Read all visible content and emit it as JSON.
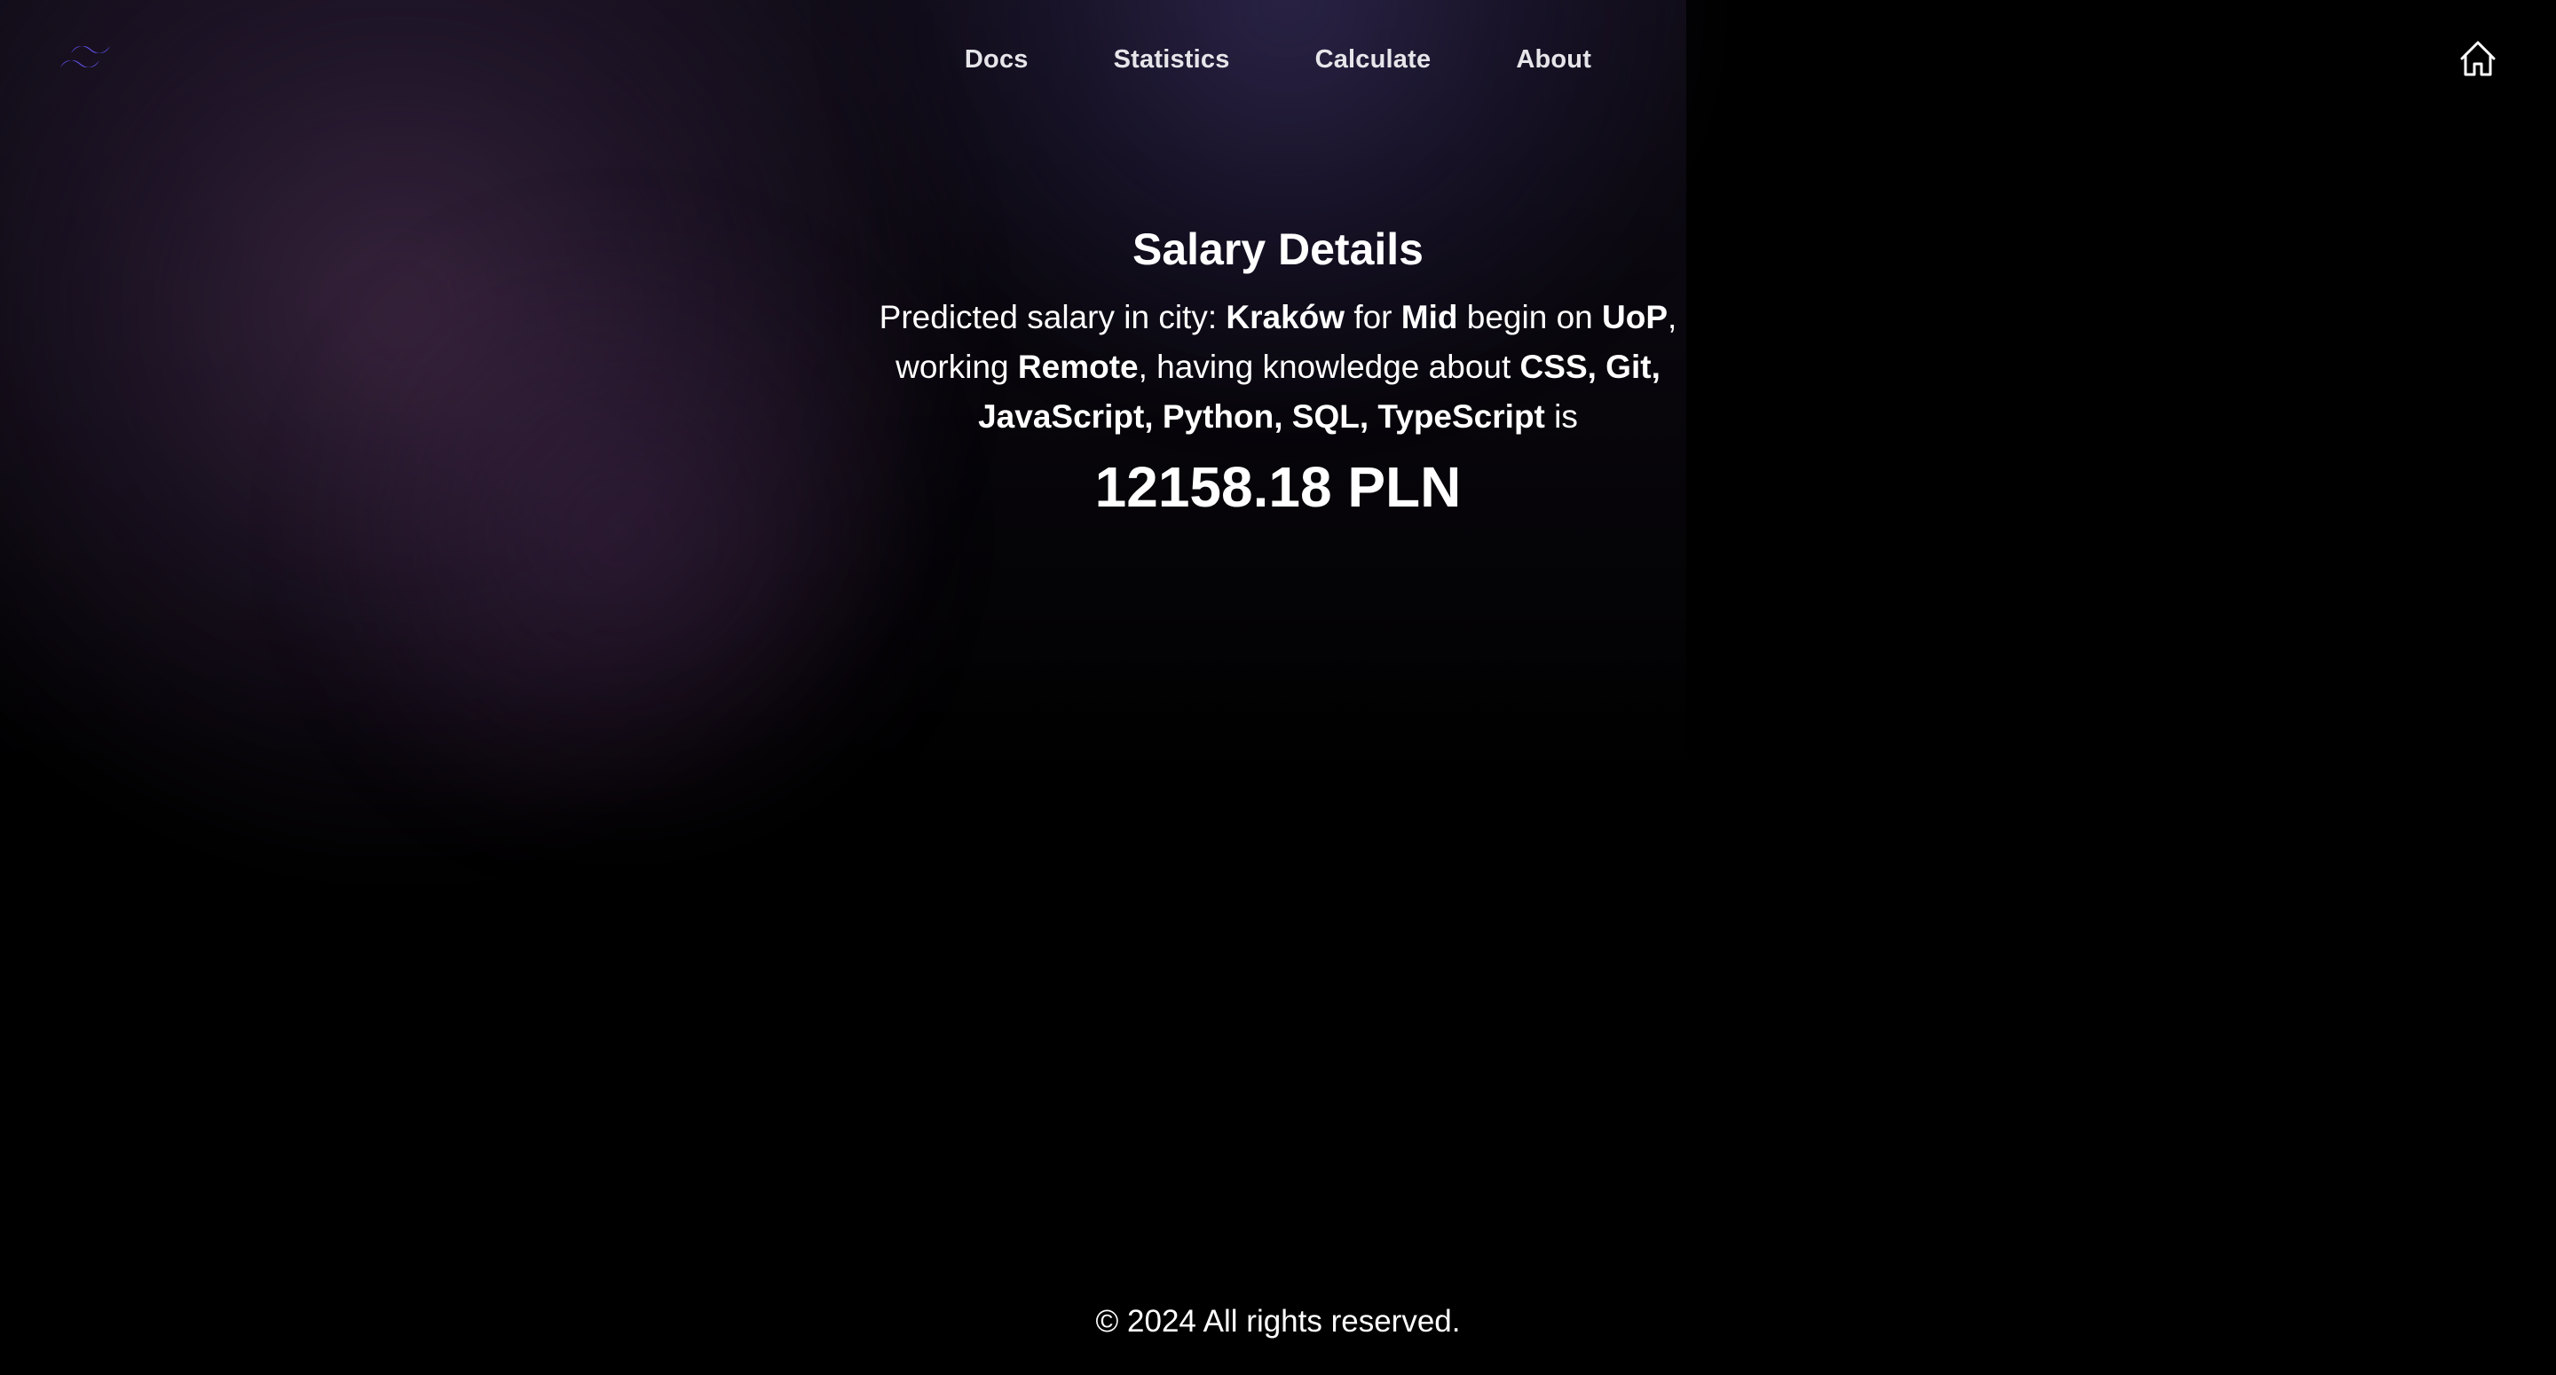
{
  "nav": {
    "logo_icon": "tailwind-wave-logo",
    "accent_color": "#5b4fe0",
    "items": [
      {
        "label": "Docs"
      },
      {
        "label": "Statistics"
      },
      {
        "label": "Calculate"
      },
      {
        "label": "About"
      }
    ],
    "home_icon": "home-icon"
  },
  "salary": {
    "title": "Salary Details",
    "intro": "Predicted salary in city: ",
    "city": "Kraków",
    "for_text": " for ",
    "level": "Mid",
    "begin_text": " begin on ",
    "contract": "UoP",
    "working_text": ", working ",
    "work_mode": "Remote",
    "knowledge_text": ", having knowledge about ",
    "skills": "CSS, Git, JavaScript, Python, SQL, TypeScript",
    "is_text": " is",
    "amount": "12158.18 PLN"
  },
  "footer": {
    "text": "© 2024 All rights reserved."
  }
}
